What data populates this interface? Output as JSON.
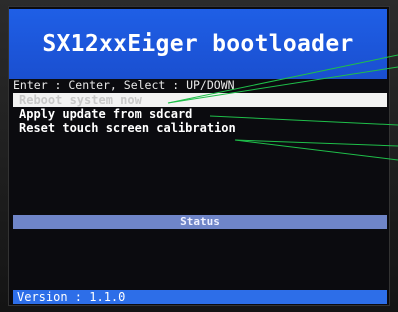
{
  "header": {
    "title": "SX12xxEiger bootloader"
  },
  "instructions": "Enter : Center, Select : UP/DOWN",
  "menu": {
    "items": [
      {
        "label": "Reboot system now",
        "selected": true
      },
      {
        "label": "Apply update from sdcard",
        "selected": false
      },
      {
        "label": "Reset touch screen calibration",
        "selected": false
      }
    ]
  },
  "status": {
    "label": "Status"
  },
  "footer": {
    "version": "Version : 1.1.0"
  },
  "colors": {
    "title_bar": "#1f5fe6",
    "status_bar": "#6f85c8",
    "version_bar": "#2d6ee8",
    "selection": "#f2f2f2",
    "callout_lines": "#1fbf4a"
  }
}
